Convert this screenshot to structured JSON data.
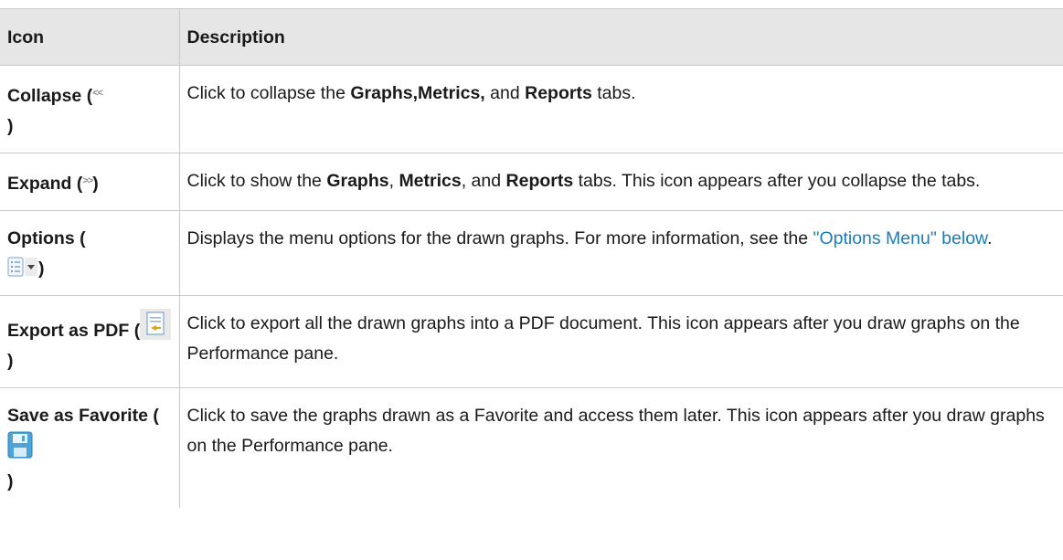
{
  "table": {
    "headers": {
      "icon": "Icon",
      "description": "Description"
    },
    "collapse": {
      "name_pre": "Collapse (",
      "glyph": "<<",
      "name_post": ")",
      "desc_pre": "Click to collapse the ",
      "b1": "Graphs,Metrics,",
      "mid1": " and ",
      "b2": "Reports",
      "desc_post": " tabs."
    },
    "expand": {
      "name_pre": "Expand (",
      "glyph": ">>",
      "name_post": ")",
      "desc_pre": "Click to show the ",
      "b1": "Graphs",
      "sep1": ", ",
      "b2": "Metrics",
      "sep2": ", and ",
      "b3": "Reports",
      "desc_post": " tabs. This icon appears after you collapse the tabs."
    },
    "options": {
      "name_pre": "Options (",
      "name_post": ")",
      "desc_pre": "Displays the menu options for the drawn graphs. For more information, see the ",
      "link": "\"Options Menu\" below",
      "desc_post": "."
    },
    "export_pdf": {
      "name_pre": "Export as PDF (",
      "name_post": ")",
      "desc": "Click to export all the drawn graphs into a PDF document. This icon appears after you draw graphs on the Performance pane."
    },
    "save_favorite": {
      "name_pre": "Save as Favorite (",
      "name_post": ")",
      "desc": "Click to save the graphs drawn as a Favorite and access them later. This icon appears after you draw graphs on the Performance pane."
    }
  },
  "icons": {
    "collapse": "double-chevron-left-icon",
    "expand": "double-chevron-right-icon",
    "options": "options-menu-icon",
    "export_pdf": "export-pdf-icon",
    "save_favorite": "save-favorite-icon"
  },
  "colors": {
    "link": "#1b7db8",
    "header_bg": "#e6e6e6",
    "border": "#c9c9c9"
  }
}
